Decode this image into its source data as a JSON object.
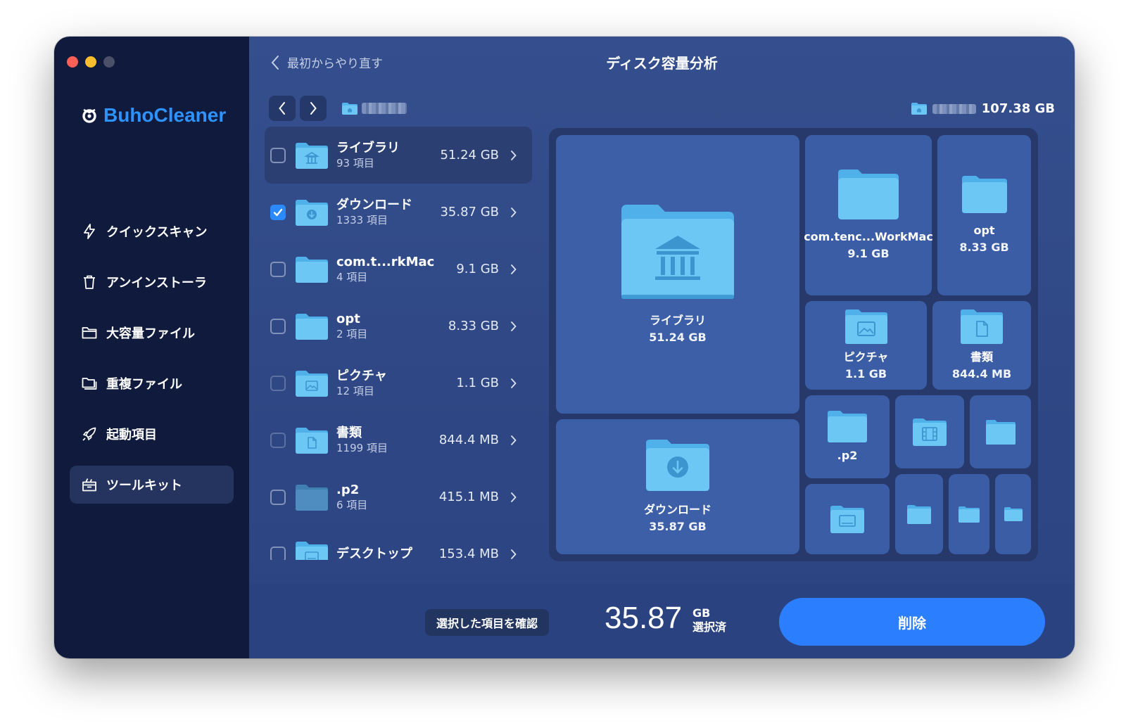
{
  "app": {
    "brand": "BuhoCleaner"
  },
  "sidebar": {
    "items": [
      {
        "label": "クイックスキャン",
        "icon": "lightning-icon"
      },
      {
        "label": "アンインストーラ",
        "icon": "trash-icon"
      },
      {
        "label": "大容量ファイル",
        "icon": "folder-icon"
      },
      {
        "label": "重複ファイル",
        "icon": "duplicate-folder-icon"
      },
      {
        "label": "起動項目",
        "icon": "rocket-icon"
      },
      {
        "label": "ツールキット",
        "icon": "toolkit-icon",
        "active": true
      }
    ]
  },
  "header": {
    "back_label": "最初からやり直す",
    "title": "ディスク容量分析",
    "total_size": "107.38 GB"
  },
  "list": [
    {
      "name": "ライブラリ",
      "count": "93 項目",
      "size": "51.24 GB",
      "checked": false,
      "icon": "library-folder-icon"
    },
    {
      "name": "ダウンロード",
      "count": "1333 項目",
      "size": "35.87 GB",
      "checked": true,
      "icon": "download-folder-icon"
    },
    {
      "name": "com.t...rkMac",
      "count": "4 項目",
      "size": "9.1 GB",
      "checked": false,
      "icon": "folder-icon"
    },
    {
      "name": "opt",
      "count": "2 項目",
      "size": "8.33 GB",
      "checked": false,
      "icon": "folder-icon"
    },
    {
      "name": "ピクチャ",
      "count": "12 項目",
      "size": "1.1 GB",
      "checked": false,
      "icon": "pictures-folder-icon"
    },
    {
      "name": "書類",
      "count": "1199 項目",
      "size": "844.4 MB",
      "checked": false,
      "icon": "documents-folder-icon"
    },
    {
      "name": ".p2",
      "count": "6 項目",
      "size": "415.1 MB",
      "checked": false,
      "icon": "folder-icon"
    },
    {
      "name": "デスクトップ",
      "count": "",
      "size": "153.4 MB",
      "checked": false,
      "icon": "desktop-folder-icon"
    }
  ],
  "treemap": {
    "library": {
      "label": "ライブラリ",
      "size": "51.24 GB"
    },
    "downloads": {
      "label": "ダウンロード",
      "size": "35.87 GB"
    },
    "com": {
      "label": "com.tenc...WorkMac",
      "size": "9.1 GB"
    },
    "opt": {
      "label": "opt",
      "size": "8.33 GB"
    },
    "pictures": {
      "label": "ピクチャ",
      "size": "1.1 GB"
    },
    "documents": {
      "label": "書類",
      "size": "844.4 MB"
    },
    "p2": {
      "label": ".p2"
    }
  },
  "footer": {
    "confirm_label": "選択した項目を確認",
    "selected_value": "35.87",
    "selected_unit": "GB",
    "selected_caption": "選択済",
    "delete_label": "削除"
  },
  "colors": {
    "sidebar_bg": "#0f1a3c",
    "main_bg": "#354f8e",
    "accent": "#2b7fff",
    "brand": "#2e92ff",
    "folder": "#6cc7f5"
  }
}
